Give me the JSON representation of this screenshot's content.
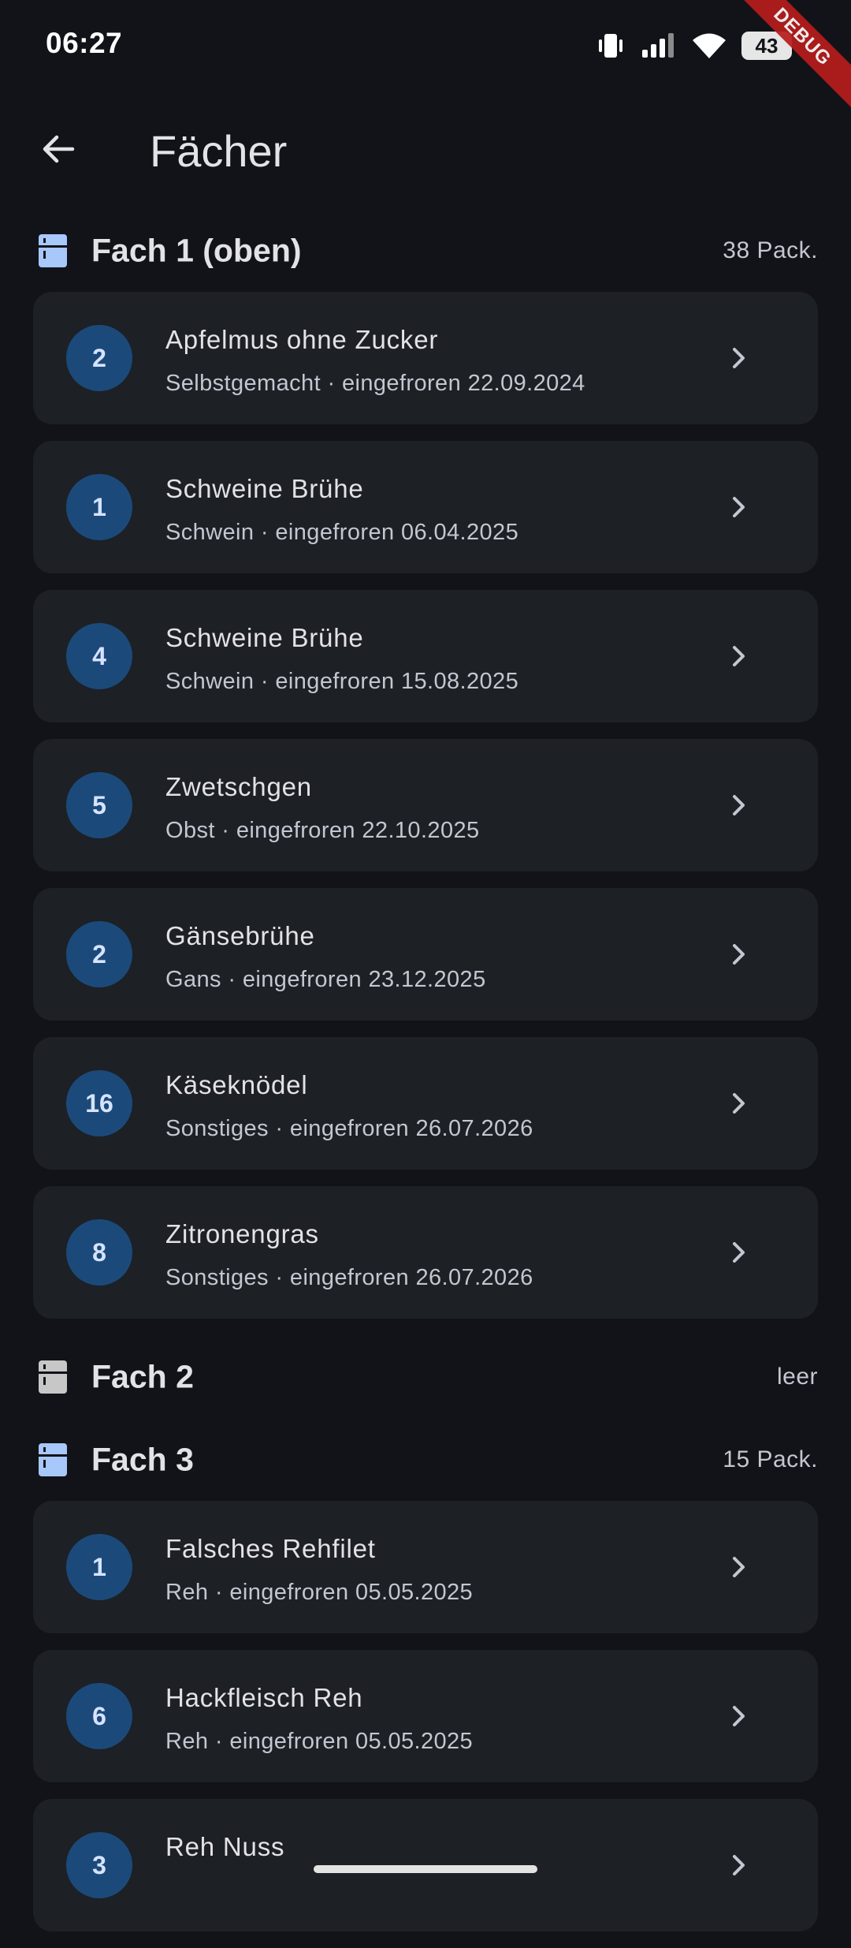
{
  "status_bar": {
    "time": "06:27",
    "battery_level": "43",
    "icons": [
      "vibrate-icon",
      "signal-icon",
      "wifi-icon",
      "battery-icon"
    ],
    "debug_label": "DEBUG"
  },
  "app_bar": {
    "back_icon": "arrow-back-icon",
    "title": "Fächer"
  },
  "colors": {
    "background": "#111318",
    "card": "#1d2025",
    "badge": "#1b4a7a",
    "badge_text": "#d6e3ff",
    "section_icon_filled": "#a8c7fa",
    "section_icon_empty": "#c7c7c7",
    "debug_banner": "#b71c1c"
  },
  "sections": [
    {
      "title": "Fach 1 (oben)",
      "count": "38 Pack.",
      "icon": "fridge-icon",
      "items": [
        {
          "qty": "2",
          "name": "Apfelmus ohne Zucker",
          "detail": "Selbstgemacht · eingefroren 22.09.2024"
        },
        {
          "qty": "1",
          "name": "Schweine Brühe",
          "detail": "Schwein · eingefroren 06.04.2025"
        },
        {
          "qty": "4",
          "name": "Schweine Brühe",
          "detail": "Schwein · eingefroren 15.08.2025"
        },
        {
          "qty": "5",
          "name": "Zwetschgen",
          "detail": "Obst · eingefroren 22.10.2025"
        },
        {
          "qty": "2",
          "name": "Gänsebrühe",
          "detail": "Gans · eingefroren 23.12.2025"
        },
        {
          "qty": "16",
          "name": "Käseknödel",
          "detail": "Sonstiges · eingefroren 26.07.2026"
        },
        {
          "qty": "8",
          "name": "Zitronengras",
          "detail": "Sonstiges · eingefroren 26.07.2026"
        }
      ]
    },
    {
      "title": "Fach 2",
      "count": "leer",
      "icon": "fridge-icon",
      "items": []
    },
    {
      "title": "Fach 3",
      "count": "15 Pack.",
      "icon": "fridge-icon",
      "items": [
        {
          "qty": "1",
          "name": "Falsches Rehfilet",
          "detail": "Reh · eingefroren 05.05.2025"
        },
        {
          "qty": "6",
          "name": "Hackfleisch Reh",
          "detail": "Reh · eingefroren 05.05.2025"
        },
        {
          "qty": "3",
          "name": "Reh Nuss",
          "detail": ""
        }
      ]
    }
  ]
}
